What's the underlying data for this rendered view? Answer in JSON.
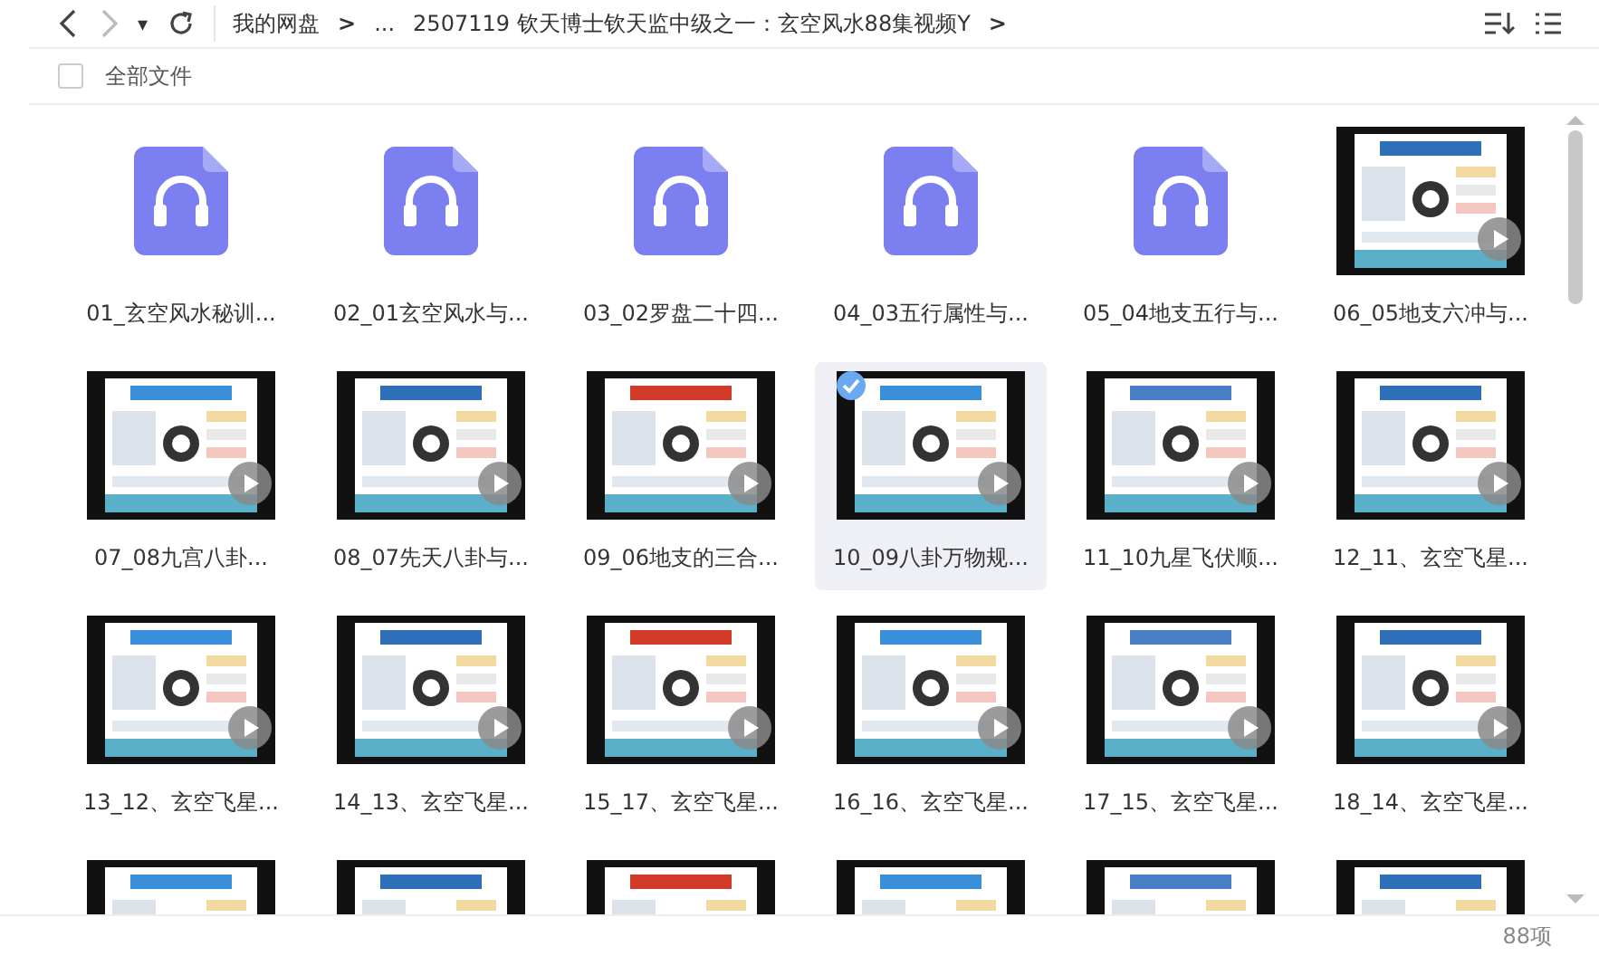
{
  "toolbar": {
    "dropdown": "▾",
    "breadcrumb": [
      {
        "label": "我的网盘"
      },
      {
        "label": "..."
      },
      {
        "label": "2507119 钦天博士钦天监中级之一：玄空风水88集视频Y"
      }
    ],
    "separator": ">"
  },
  "header": {
    "label": "全部文件",
    "checked": false
  },
  "files": [
    {
      "kind": "audio",
      "label": "01_玄空风水秘训...",
      "selected": false
    },
    {
      "kind": "audio",
      "label": "02_01玄空风水与...",
      "selected": false
    },
    {
      "kind": "audio",
      "label": "03_02罗盘二十四...",
      "selected": false
    },
    {
      "kind": "audio",
      "label": "04_03五行属性与...",
      "selected": false
    },
    {
      "kind": "audio",
      "label": "05_04地支五行与...",
      "selected": false
    },
    {
      "kind": "video",
      "label": "06_05地支六冲与...",
      "selected": false
    },
    {
      "kind": "video",
      "label": "07_08九宫八卦...",
      "selected": false
    },
    {
      "kind": "video",
      "label": "08_07先天八卦与...",
      "selected": false
    },
    {
      "kind": "video",
      "label": "09_06地支的三合...",
      "selected": false
    },
    {
      "kind": "video",
      "label": "10_09八卦万物规...",
      "selected": true
    },
    {
      "kind": "video",
      "label": "11_10九星飞伏顺...",
      "selected": false
    },
    {
      "kind": "video",
      "label": "12_11、玄空飞星...",
      "selected": false
    },
    {
      "kind": "video",
      "label": "13_12、玄空飞星...",
      "selected": false
    },
    {
      "kind": "video",
      "label": "14_13、玄空飞星...",
      "selected": false
    },
    {
      "kind": "video",
      "label": "15_17、玄空飞星...",
      "selected": false
    },
    {
      "kind": "video",
      "label": "16_16、玄空飞星...",
      "selected": false
    },
    {
      "kind": "video",
      "label": "17_15、玄空飞星...",
      "selected": false
    },
    {
      "kind": "video",
      "label": "18_14、玄空飞星...",
      "selected": false
    },
    {
      "kind": "video",
      "selected": false
    },
    {
      "kind": "video",
      "selected": false
    },
    {
      "kind": "video",
      "selected": false
    },
    {
      "kind": "video",
      "selected": false
    },
    {
      "kind": "video",
      "selected": false
    },
    {
      "kind": "video",
      "selected": false
    }
  ],
  "status_bar": {
    "count": "88项"
  }
}
